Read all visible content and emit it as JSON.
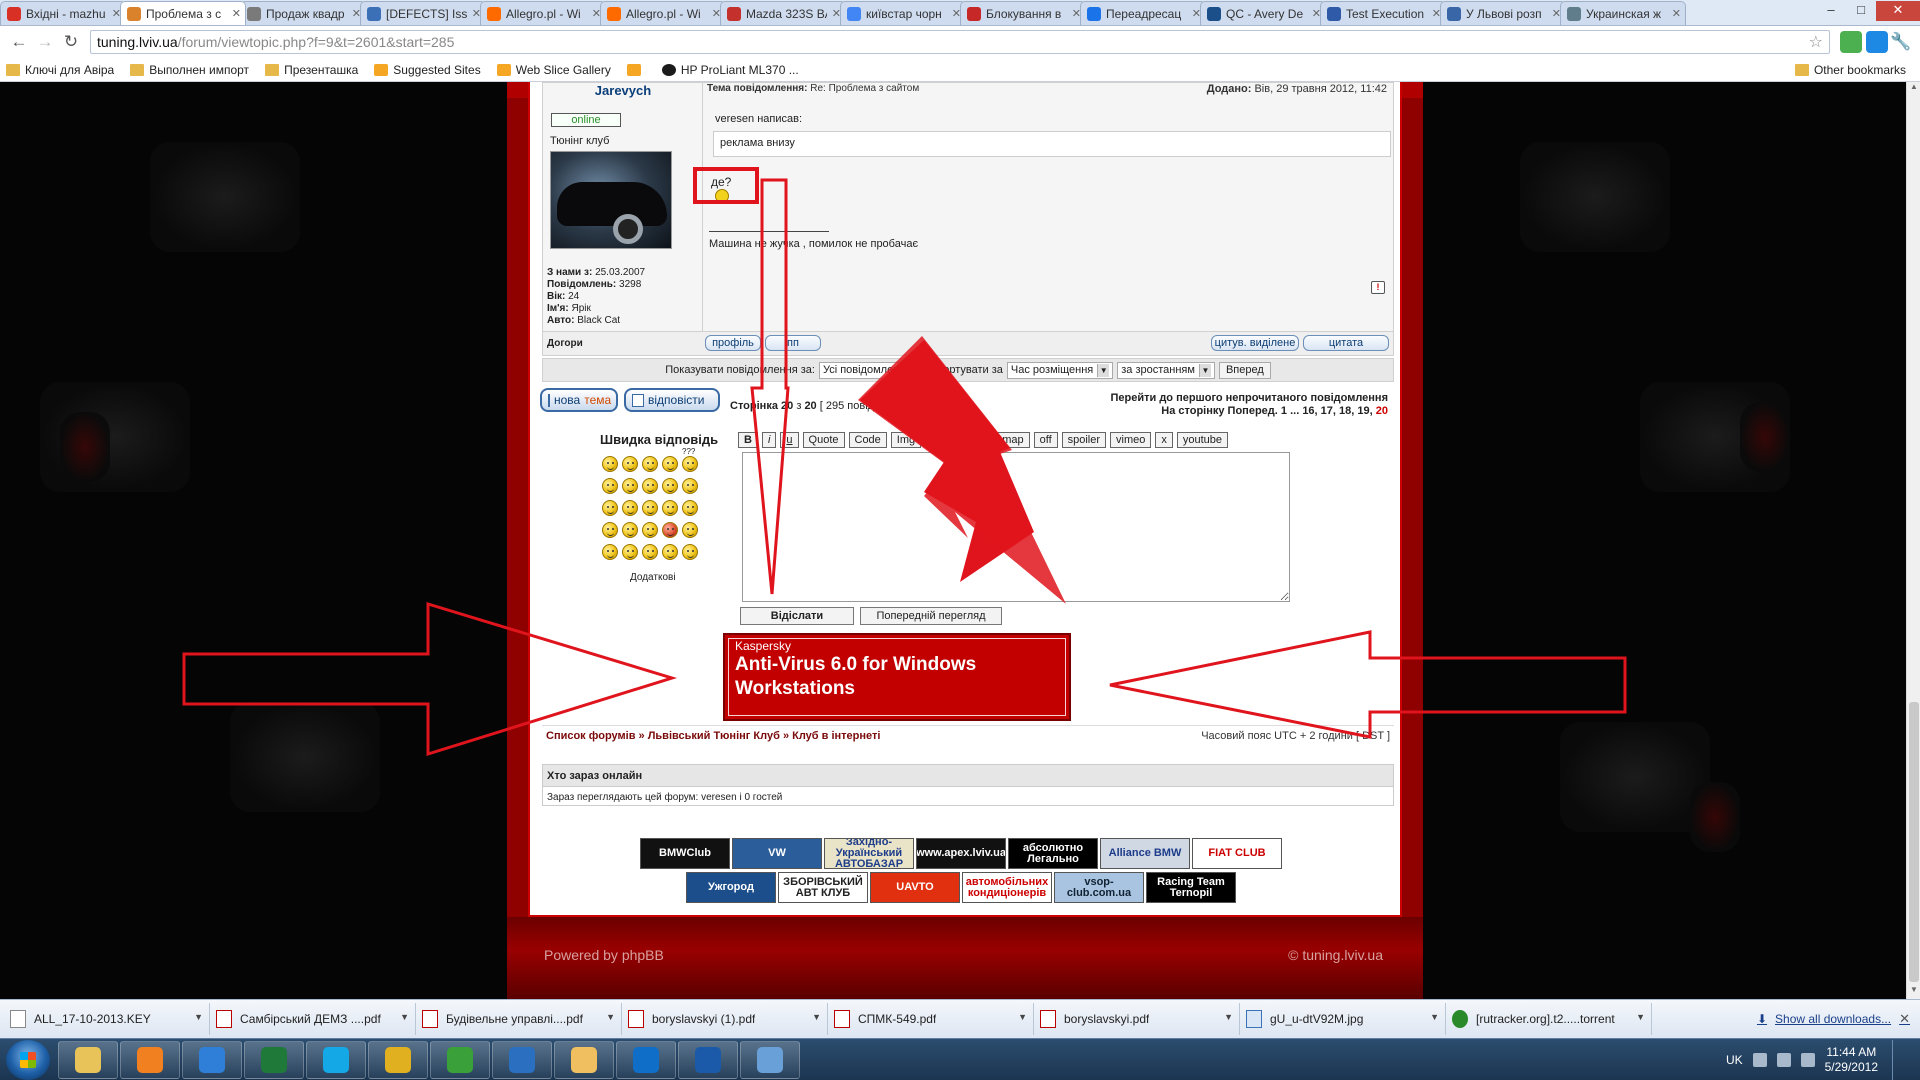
{
  "browser": {
    "tabs": [
      {
        "title": "Вхідні - mazhu",
        "color": "#d93025",
        "active": false
      },
      {
        "title": "Проблема з с",
        "color": "#d9822b",
        "active": true
      },
      {
        "title": "Продаж квадр",
        "color": "#7a7a7a",
        "active": false
      },
      {
        "title": "[DEFECTS] Issu",
        "color": "#3b6fb6",
        "active": false
      },
      {
        "title": "Allegro.pl - Wi",
        "color": "#ff6a00",
        "active": false
      },
      {
        "title": "Allegro.pl - Wi",
        "color": "#ff6a00",
        "active": false
      },
      {
        "title": "Mazda 323S BA",
        "color": "#c4302b",
        "active": false
      },
      {
        "title": "київстар чорн",
        "color": "#4285f4",
        "active": false
      },
      {
        "title": "Блокування в",
        "color": "#c62828",
        "active": false
      },
      {
        "title": "Переадресац",
        "color": "#1a73e8",
        "active": false
      },
      {
        "title": "QC - Avery De",
        "color": "#1b4f8a",
        "active": false
      },
      {
        "title": "Test Execution",
        "color": "#2f5aa8",
        "active": false
      },
      {
        "title": "У Львові розп",
        "color": "#3866a7",
        "active": false
      },
      {
        "title": "Украинская ж",
        "color": "#607d8b",
        "active": false
      }
    ],
    "window_controls": {
      "minimize": "–",
      "maximize": "□",
      "close": "✕"
    },
    "url_host": "tuning.lviv.ua",
    "url_path": "/forum/viewtopic.php?f=9&t=2601&start=285",
    "bookmarks": [
      {
        "label": "Ключі для Авіра",
        "icon": "folder-icon"
      },
      {
        "label": "Выполнен импорт",
        "icon": "folder-icon"
      },
      {
        "label": "Презенташка",
        "icon": "folder-icon"
      },
      {
        "label": "Suggested Sites",
        "icon": "page-icon"
      },
      {
        "label": "Web Slice Gallery",
        "icon": "page-icon"
      },
      {
        "label": "",
        "icon": "page-icon"
      },
      {
        "label": "HP ProLiant ML370 ...",
        "icon": "hp-icon"
      }
    ],
    "other_bookmarks": "Other bookmarks"
  },
  "post": {
    "author": "Jarevych",
    "status": "online",
    "club": "Тюнінг клуб",
    "meta": [
      {
        "label": "З нами з:",
        "value": "25.03.2007"
      },
      {
        "label": "Повідомлень:",
        "value": "3298"
      },
      {
        "label": "Вік:",
        "value": "24"
      },
      {
        "label": "Ім'я:",
        "value": "Ярік"
      },
      {
        "label": "Авто:",
        "value": "Black Cat"
      }
    ],
    "title_label": "Тема повідомлення:",
    "title": "Re: Проблема з сайтом",
    "date_label": "Додано:",
    "date": "Вів, 29 травня 2012, 11:42",
    "quote_author": "veresen написав:",
    "quote_text": "реклама внизу",
    "reply_text": "де?",
    "signature": "Машина не жучка , помилок не пробачає",
    "back_to_top": "Догори",
    "buttons": {
      "profile": "профіль",
      "pm": "пп",
      "quote_selected": "цитув. виділене",
      "quote": "цитата"
    }
  },
  "display_options": {
    "show_label": "Показувати повідомлення за:",
    "show_value": "Усі повідомлення",
    "sort_label": "Сортувати за",
    "sort_value": "Час розміщення",
    "order_value": "за зростанням",
    "go": "Вперед"
  },
  "actions": {
    "new_topic_a": "нова",
    "new_topic_b": "тема",
    "reply": "відповісти",
    "page_label": "Сторінка",
    "page_current": "20",
    "page_sep": "з",
    "page_total": "20",
    "post_count": "[ 295 повідомлень ]",
    "first_unread": "Перейти до першого непрочитаного повідомлення",
    "goto_label": "На сторінку Поперед.",
    "pages": [
      "1",
      "...",
      "16,",
      "17,",
      "18,",
      "19,"
    ],
    "current_page": "20"
  },
  "quick_reply": {
    "title": "Швидка відповідь",
    "bbcodes": [
      "B",
      "i",
      "u",
      "Quote",
      "Code",
      "Img",
      "URL",
      "googlemap",
      "off",
      "spoiler",
      "vimeo",
      "x",
      "youtube"
    ],
    "more_smileys": "Додаткові",
    "submit": "Відіслати",
    "preview": "Попередній перегляд",
    "smiley_extra_label": "???"
  },
  "ad": {
    "brand": "Kaspersky",
    "product": "Anti-Virus 6.0 for Windows Workstations"
  },
  "breadcrumb": {
    "items": [
      "Список форумів",
      "Львівський Тюнінг Клуб",
      "Клуб в інтернеті"
    ],
    "separator": "»",
    "timezone": "Часовий пояс UTC + 2 години [ DST ]"
  },
  "who_online": {
    "title": "Хто зараз онлайн",
    "text": "Зараз переглядають цей форум: veresen і 0 гостей"
  },
  "partners_row1": [
    {
      "text": "BMWClub",
      "bg": "#111",
      "fg": "#fff"
    },
    {
      "text": "VW",
      "bg": "#2b5d9a",
      "fg": "#fff"
    },
    {
      "text": "Західно-Український АВТОБАЗАР",
      "bg": "#e9e4c8",
      "fg": "#1d3c8a"
    },
    {
      "text": "www.apex.lviv.ua",
      "bg": "#111",
      "fg": "#fff"
    },
    {
      "text": "абсолютно Легально",
      "bg": "#000",
      "fg": "#fff"
    },
    {
      "text": "Alliance BMW",
      "bg": "#d0d8e4",
      "fg": "#1d3c8a"
    },
    {
      "text": "FIAT CLUB",
      "bg": "#ffffff",
      "fg": "#c00"
    }
  ],
  "partners_row2": [
    {
      "text": "Ужгород",
      "bg": "#1c4e8c",
      "fg": "#fff"
    },
    {
      "text": "ЗБОРІВСЬКИЙ АВТ КЛУБ",
      "bg": "#fff",
      "fg": "#222"
    },
    {
      "text": "UAVTO",
      "bg": "#e03010",
      "fg": "#fff"
    },
    {
      "text": "автомобільних кондиціонерів",
      "bg": "#fff",
      "fg": "#c00"
    },
    {
      "text": "vsop-club.com.ua",
      "bg": "#a8c4e0",
      "fg": "#123"
    },
    {
      "text": "Racing Team Ternopil",
      "bg": "#000",
      "fg": "#fff"
    }
  ],
  "footer": {
    "powered": "Powered by phpBB",
    "copyright": "© tuning.lviv.ua"
  },
  "downloads": [
    {
      "name": "ALL_17-10-2013.KEY",
      "type": "doc"
    },
    {
      "name": "Самбірський ДЕМЗ ....pdf",
      "type": "pdf"
    },
    {
      "name": "Будівельне управлі....pdf",
      "type": "pdf"
    },
    {
      "name": "boryslavskyi (1).pdf",
      "type": "pdf"
    },
    {
      "name": "СПМК-549.pdf",
      "type": "pdf"
    },
    {
      "name": "boryslavskyi.pdf",
      "type": "pdf"
    },
    {
      "name": "gU_u-dtV92M.jpg",
      "type": "img"
    },
    {
      "name": "[rutracker.org].t2.....torrent",
      "type": "tor"
    }
  ],
  "show_all_downloads": "Show all downloads...",
  "taskbar": {
    "apps": [
      {
        "name": "explorer",
        "color": "#e8c35a"
      },
      {
        "name": "media-player",
        "color": "#f08020"
      },
      {
        "name": "internet-explorer",
        "color": "#2f7fd8"
      },
      {
        "name": "excel",
        "color": "#1f7a3a"
      },
      {
        "name": "skype",
        "color": "#14a8e6"
      },
      {
        "name": "chrome",
        "color": "#e0b020"
      },
      {
        "name": "utorrent",
        "color": "#3aa03a"
      },
      {
        "name": "outlook",
        "color": "#2a6fc0"
      },
      {
        "name": "notes",
        "color": "#f0c060"
      },
      {
        "name": "teamviewer",
        "color": "#0e6ec8"
      },
      {
        "name": "app-s",
        "color": "#1a5aa8"
      },
      {
        "name": "remote-desktop",
        "color": "#6aa0d8"
      }
    ],
    "language": "UK",
    "time": "11:44 AM",
    "date": "5/29/2012"
  },
  "colors": {
    "annotation_red": "#e0141c",
    "forum_red": "#b00000"
  }
}
